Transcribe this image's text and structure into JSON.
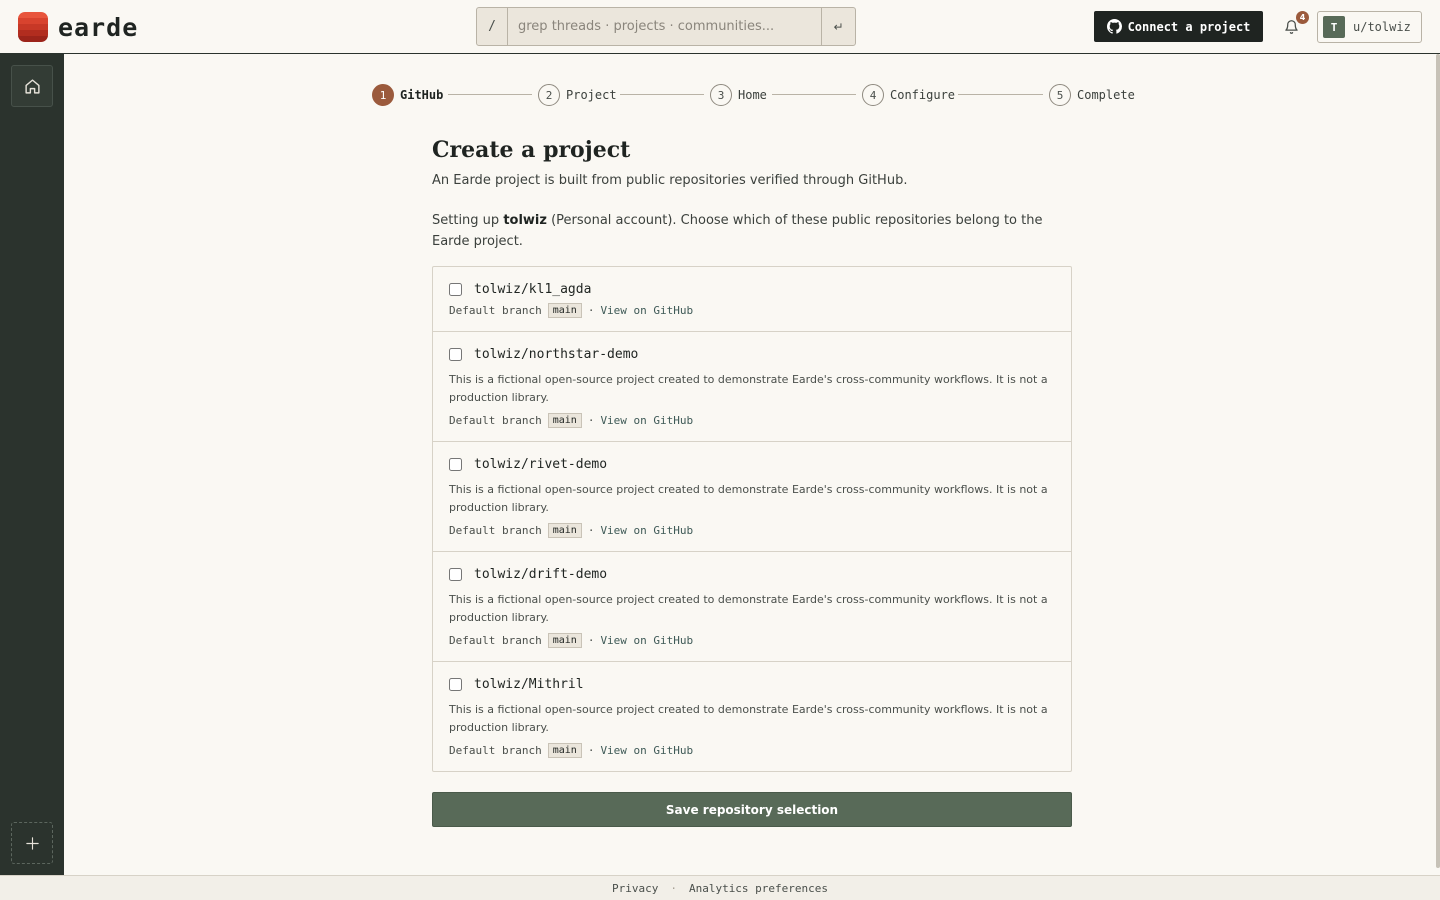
{
  "brand": {
    "name": "earde",
    "stripe_colors": [
      "#e8553c",
      "#d8432e",
      "#c73826",
      "#b22d1f",
      "#9c241a"
    ]
  },
  "search": {
    "prefix": "/",
    "placeholder": "grep threads · projects · communities...",
    "enter_glyph": "↵"
  },
  "header": {
    "connect_label": "Connect a project",
    "notification_count": "4",
    "user_initial": "T",
    "user_handle": "u/tolwiz"
  },
  "sidebar": {
    "home_icon": "home-icon",
    "add_icon": "plus-icon"
  },
  "stepper": [
    {
      "number": "1",
      "label": "GitHub",
      "active": true
    },
    {
      "number": "2",
      "label": "Project",
      "active": false
    },
    {
      "number": "3",
      "label": "Home",
      "active": false
    },
    {
      "number": "4",
      "label": "Configure",
      "active": false
    },
    {
      "number": "5",
      "label": "Complete",
      "active": false
    }
  ],
  "page": {
    "title": "Create a project",
    "subtitle": "An Earde project is built from public repositories verified through GitHub.",
    "intro_before": "Setting up ",
    "intro_account": "tolwiz",
    "intro_after": " (Personal account). Choose which of these public repositories belong to the Earde project."
  },
  "repos": [
    {
      "name": "tolwiz/kl1_agda",
      "description": "",
      "branch_label": "Default branch",
      "branch": "main",
      "sep": "·",
      "link": "View on GitHub",
      "checked": false
    },
    {
      "name": "tolwiz/northstar-demo",
      "description": "This is a fictional open-source project created to demonstrate Earde's cross-community workflows. It is not a production library.",
      "branch_label": "Default branch",
      "branch": "main",
      "sep": "·",
      "link": "View on GitHub",
      "checked": false
    },
    {
      "name": "tolwiz/rivet-demo",
      "description": "This is a fictional open-source project created to demonstrate Earde's cross-community workflows. It is not a production library.",
      "branch_label": "Default branch",
      "branch": "main",
      "sep": "·",
      "link": "View on GitHub",
      "checked": false
    },
    {
      "name": "tolwiz/drift-demo",
      "description": "This is a fictional open-source project created to demonstrate Earde's cross-community workflows. It is not a production library.",
      "branch_label": "Default branch",
      "branch": "main",
      "sep": "·",
      "link": "View on GitHub",
      "checked": false
    },
    {
      "name": "tolwiz/Mithril",
      "description": "This is a fictional open-source project created to demonstrate Earde's cross-community workflows. It is not a production library.",
      "branch_label": "Default branch",
      "branch": "main",
      "sep": "·",
      "link": "View on GitHub",
      "checked": false
    }
  ],
  "actions": {
    "save_label": "Save repository selection"
  },
  "footer": {
    "privacy": "Privacy",
    "sep": "·",
    "analytics": "Analytics preferences"
  },
  "colors": {
    "sidebar": "#2b332d",
    "accent_step": "#9b5a3c",
    "primary_button": "#586a58",
    "dark_button": "#1f2421",
    "background": "#faf8f3"
  }
}
